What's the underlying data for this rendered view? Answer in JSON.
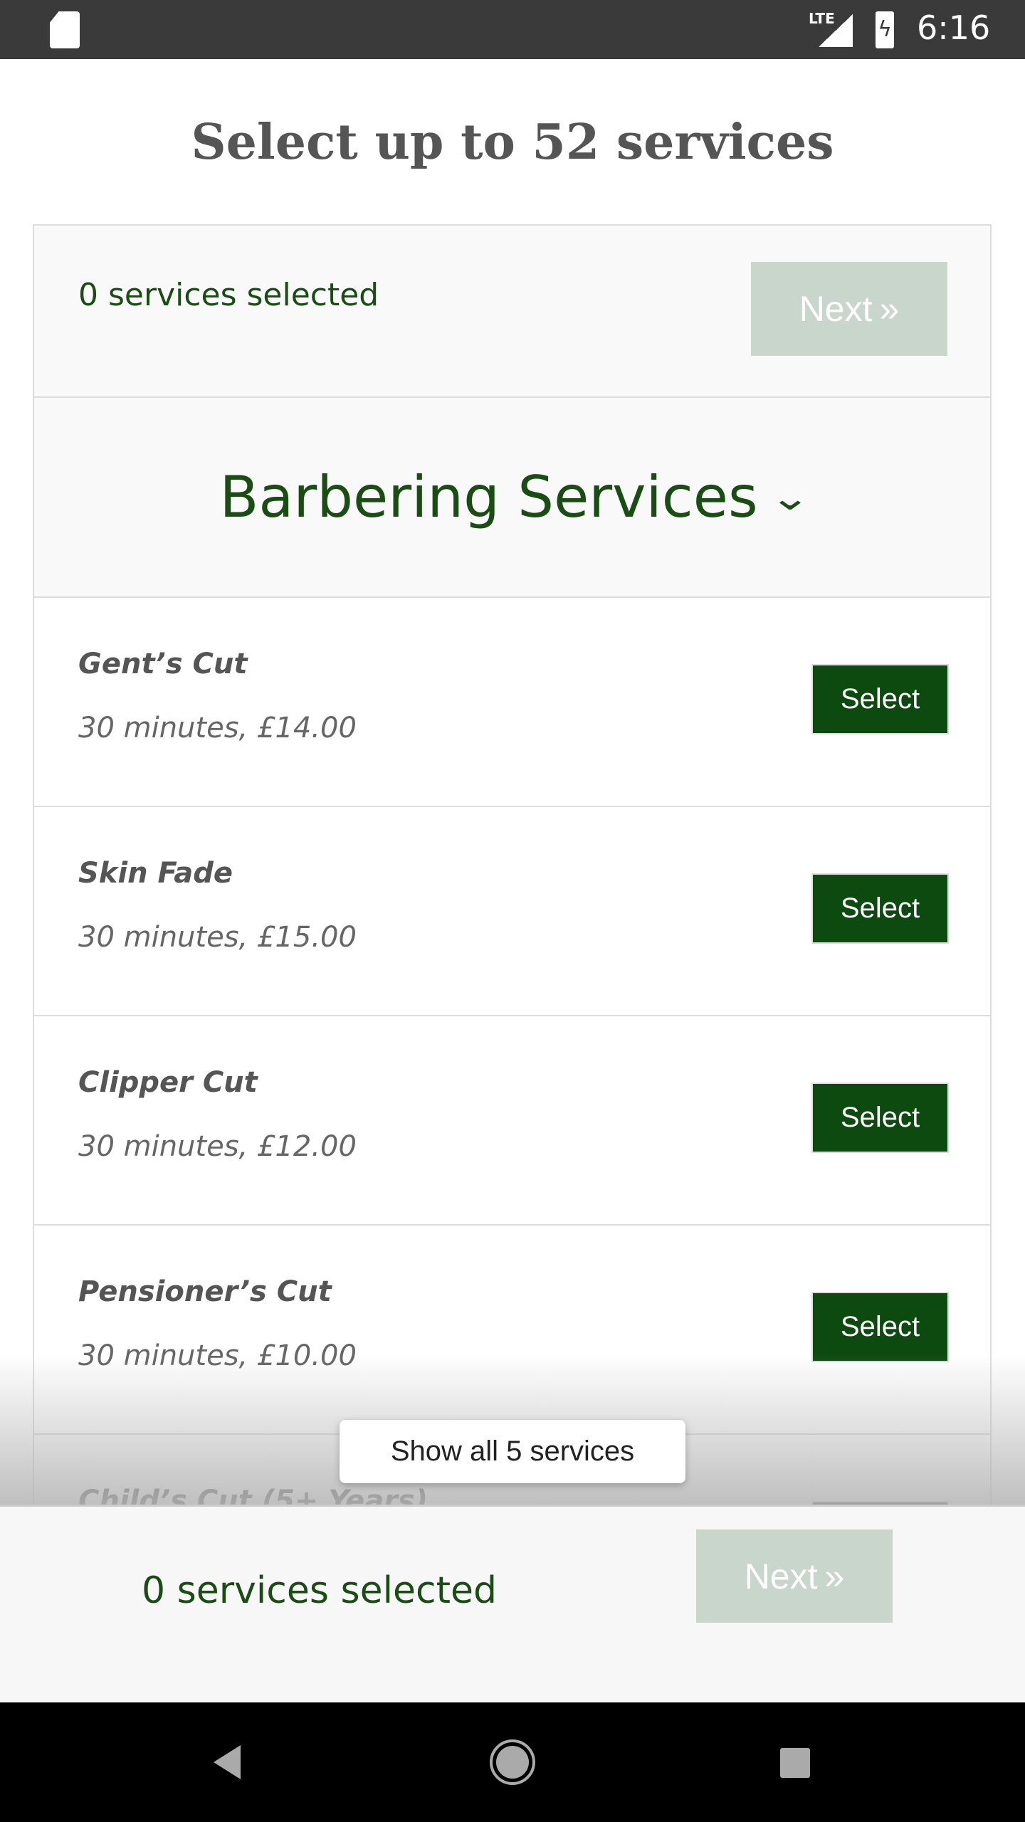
{
  "status_bar": {
    "time": "6:16",
    "network": "LTE",
    "icons": [
      "sd-card-icon",
      "signal-icon",
      "battery-charging-icon"
    ]
  },
  "title": "Select up to 52 services",
  "summary": {
    "count_text": "0 services selected",
    "next_label": "Next",
    "next_icon": "double-chevron-right-icon"
  },
  "category": {
    "name": "Barbering Services",
    "icon": "chevron-down-icon",
    "expanded": true
  },
  "services": [
    {
      "name": "Gent’s Cut",
      "details": "30 minutes, £14.00",
      "button": "Select"
    },
    {
      "name": "Skin Fade",
      "details": "30 minutes, £15.00",
      "button": "Select"
    },
    {
      "name": "Clipper Cut",
      "details": "30 minutes, £12.00",
      "button": "Select"
    },
    {
      "name": "Pensioner’s Cut",
      "details": "30 minutes, £10.00",
      "button": "Select"
    },
    {
      "name": "Child’s Cut (5+ Years)",
      "details": "",
      "button": "Select"
    }
  ],
  "show_all_label": "Show all 5 services",
  "footer": {
    "count_text": "0 services selected",
    "next_label": "Next"
  },
  "colors": {
    "brand_green": "#0d4a10",
    "text_green": "#1a4d14",
    "disabled_button": "#c9d6cb",
    "status_bar": "#3a3a3a"
  }
}
